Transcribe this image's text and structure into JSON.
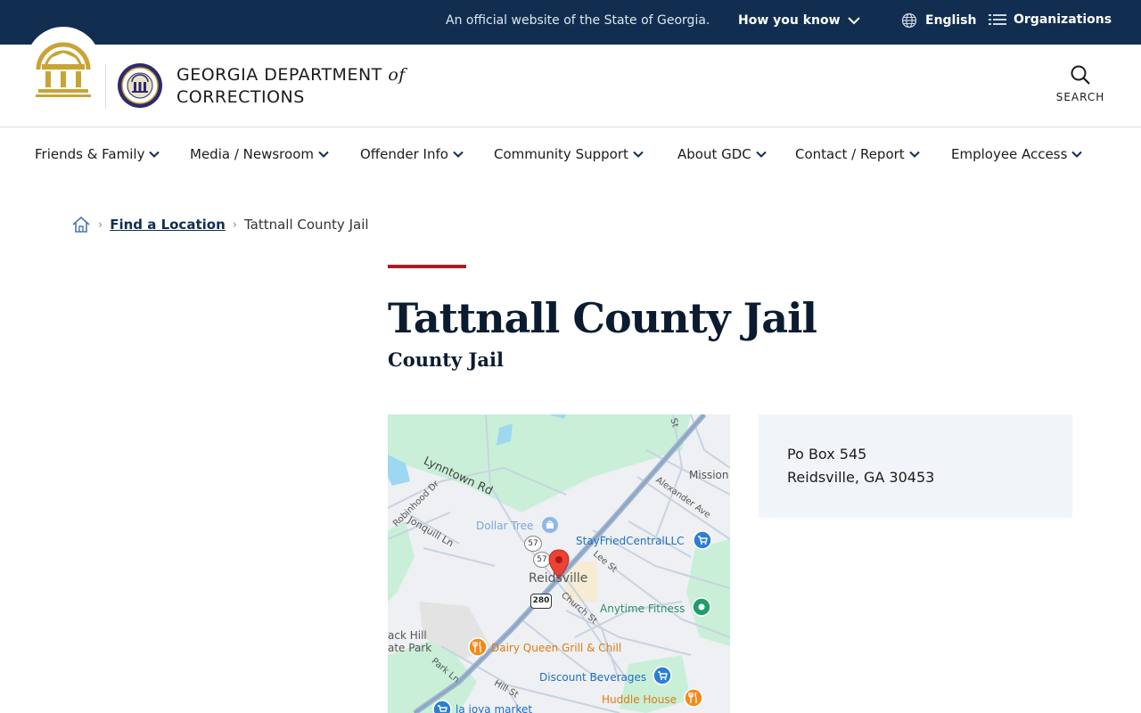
{
  "banner": {
    "official_text": "An official website of the State of Georgia.",
    "how_you_know": "How you know",
    "language": "English",
    "organizations": "Organizations"
  },
  "header": {
    "agency_line1": "GEORGIA DEPARTMENT",
    "agency_of": "of",
    "agency_line2": "CORRECTIONS",
    "search_label": "SEARCH"
  },
  "nav": {
    "items": [
      {
        "label": "Friends & Family"
      },
      {
        "label": "Media / Newsroom"
      },
      {
        "label": "Offender Info"
      },
      {
        "label": "Community Support"
      },
      {
        "label": "About GDC"
      },
      {
        "label": "Contact / Report"
      },
      {
        "label": "Employee Access"
      }
    ]
  },
  "breadcrumb": {
    "find_location": "Find a Location",
    "current": "Tattnall County Jail"
  },
  "page": {
    "title": "Tattnall County Jail",
    "subtitle": "County Jail"
  },
  "map": {
    "labels": {
      "lynntown": "Lynntown Rd",
      "robinhood": "Robinhood Dr",
      "jonquill": "Jonquill Ln",
      "dollar_tree": "Dollar Tree",
      "stayfried": "StayFriedCentralLLC",
      "mission": "Mission",
      "alexander": "Alexander Ave",
      "lee": "Lee St",
      "reidsville": "Reidsville",
      "church": "Church St",
      "anytime": "Anytime Fitness",
      "hill_park": "ack Hill\nate Park",
      "hill_park_1": "ack Hill",
      "hill_park_2": "ate Park",
      "dairy_queen": "Dairy Queen Grill & Chill",
      "park_ln": "Park Ln",
      "hill_st": "Hill St",
      "discount": "Discount Beverages",
      "huddle": "Huddle House",
      "lajoya": "la joya market",
      "route57a": "57",
      "route57b": "57",
      "route280": "280",
      "st_top": "St"
    }
  },
  "address": {
    "line1": "Po Box 545",
    "line2": "Reidsville, GA 30453"
  },
  "colors": {
    "banner_bg": "#112e51",
    "accent_red": "#a91e22",
    "gold": "#c9a435",
    "address_bg": "#f1f4f8"
  }
}
